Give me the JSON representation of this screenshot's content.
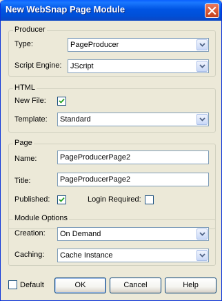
{
  "window": {
    "title": "New WebSnap Page Module"
  },
  "producer": {
    "legend": "Producer",
    "type_label": "Type:",
    "type_value": "PageProducer",
    "engine_label": "Script Engine:",
    "engine_value": "JScript"
  },
  "html": {
    "legend": "HTML",
    "newfile_label": "New File:",
    "newfile_checked": true,
    "template_label": "Template:",
    "template_value": "Standard"
  },
  "page": {
    "legend": "Page",
    "name_label": "Name:",
    "name_value": "PageProducerPage2",
    "title_label": "Title:",
    "title_value": "PageProducerPage2",
    "published_label": "Published:",
    "published_checked": true,
    "login_label": "Login Required:",
    "login_checked": false
  },
  "module": {
    "legend": "Module Options",
    "creation_label": "Creation:",
    "creation_value": "On Demand",
    "caching_label": "Caching:",
    "caching_value": "Cache Instance"
  },
  "footer": {
    "default_label": "Default",
    "default_checked": false,
    "ok_label": "OK",
    "cancel_label": "Cancel",
    "help_label": "Help"
  },
  "colors": {
    "titlebar": "#0054e3",
    "dialog_bg": "#ece9d8",
    "close_button": "#d95a36"
  },
  "icons": {
    "close": "close-icon",
    "dropdown": "chevron-down-icon",
    "check": "checkmark-icon"
  }
}
